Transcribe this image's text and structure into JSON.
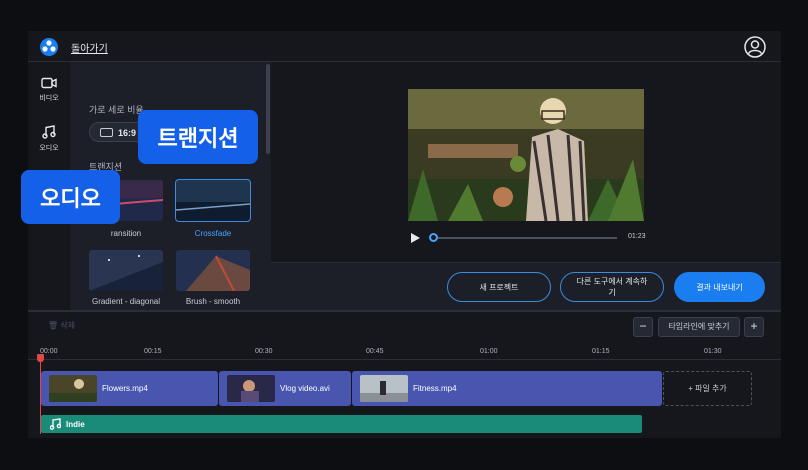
{
  "topbar": {
    "back_label": "돌아가기"
  },
  "sidenav": {
    "items": [
      {
        "label": "비디오",
        "icon": "video-camera-icon"
      },
      {
        "label": "오디오",
        "icon": "music-note-icon"
      }
    ]
  },
  "panel": {
    "ratio_label": "가로 세로 비율",
    "ratio_value": "16:9",
    "transitions_label": "트랜지션",
    "transitions": [
      {
        "label": "ransition"
      },
      {
        "label": "Crossfade",
        "selected": true
      },
      {
        "label": "Gradient - diagonal"
      },
      {
        "label": "Brush - smooth"
      }
    ]
  },
  "player": {
    "time_total": "01:23",
    "progress": 0.0
  },
  "actions": {
    "new_project": "새 프로젝트",
    "continue_other": "다른 도구에서 계속하기",
    "export": "결과 내보내기"
  },
  "timeline": {
    "delete_label": "삭제",
    "fit_label": "타임라인에 맞추기",
    "ticks": [
      "00:00",
      "00:15",
      "00:30",
      "00:45",
      "01:00",
      "01:15",
      "01:30"
    ],
    "clips": [
      {
        "name": "Flowers.mp4"
      },
      {
        "name": "Vlog video.avi"
      },
      {
        "name": "Fitness.mp4"
      }
    ],
    "add_file": "+ 파일 추가",
    "audio": {
      "name": "Indie"
    }
  },
  "callouts": {
    "transition": "트랜지션",
    "audio": "오디오"
  },
  "colors": {
    "accent": "#1a7ef0",
    "callout": "#1560e8",
    "clip": "#4856b0",
    "audio": "#1a8a79"
  }
}
